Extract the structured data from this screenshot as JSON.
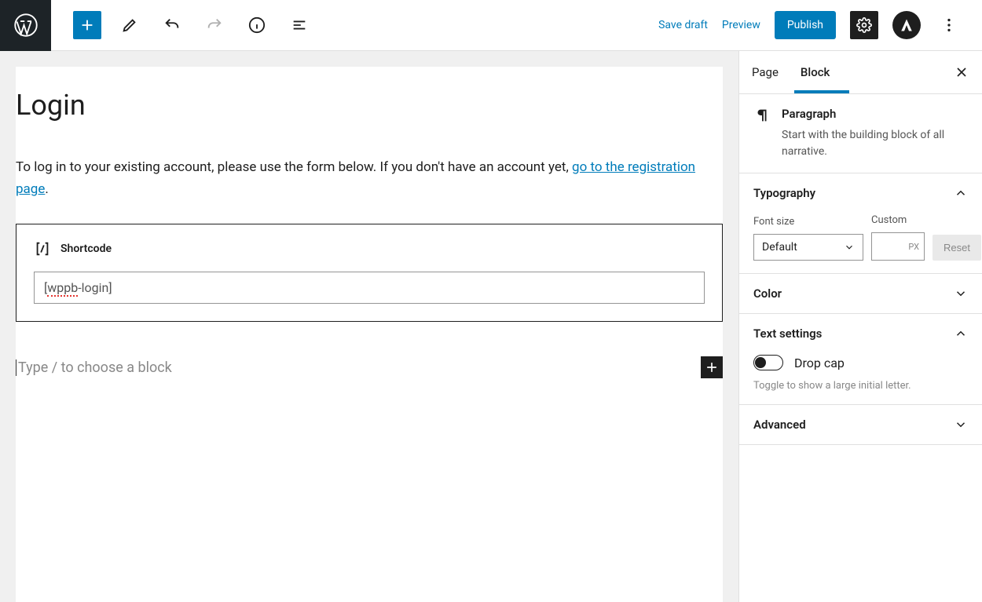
{
  "toolbar": {
    "save_draft": "Save draft",
    "preview": "Preview",
    "publish": "Publish"
  },
  "sidebar": {
    "tabs": {
      "page": "Page",
      "block": "Block"
    },
    "block_info": {
      "title": "Paragraph",
      "desc": "Start with the building block of all narrative."
    },
    "typography": {
      "title": "Typography",
      "font_size_label": "Font size",
      "custom_label": "Custom",
      "select_value": "Default",
      "unit": "PX",
      "reset": "Reset"
    },
    "color": {
      "title": "Color"
    },
    "text_settings": {
      "title": "Text settings",
      "drop_cap_label": "Drop cap",
      "help": "Toggle to show a large initial letter."
    },
    "advanced": {
      "title": "Advanced"
    }
  },
  "document": {
    "title": "Login",
    "intro_prefix": "To log in to your existing account, please use the form below. If you don't have an account yet, ",
    "intro_link": "go to the registration page",
    "intro_suffix": ".",
    "shortcode": {
      "label": "Shortcode",
      "value_prefix_open": "[",
      "value_prefix_red": "wppb",
      "value_suffix": "-login]"
    },
    "new_block_placeholder": "Type / to choose a block"
  }
}
